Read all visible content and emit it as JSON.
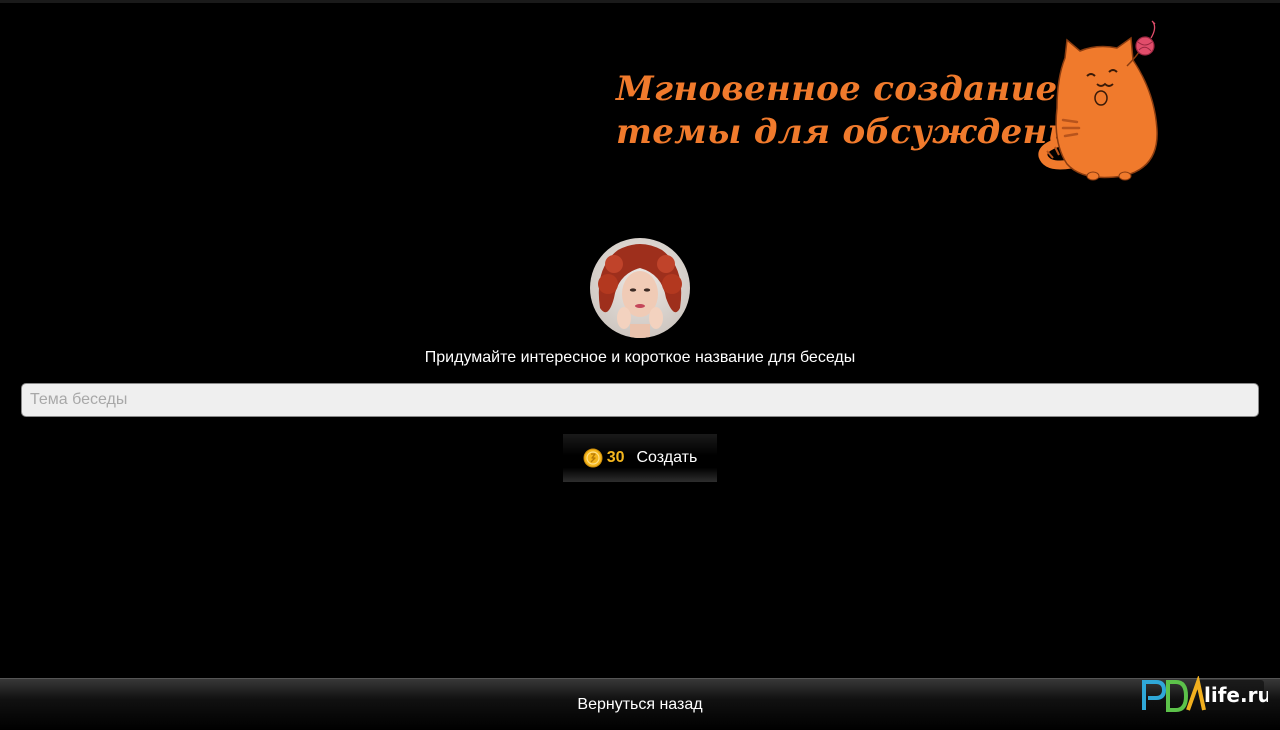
{
  "promo": {
    "line1": "Мгновенное создание",
    "line2": "темы для обсуждения!",
    "mascot_icon": "cat-with-yarn-icon",
    "accent_color": "#f07a2c"
  },
  "profile": {
    "avatar_icon": "user-avatar-photo"
  },
  "form": {
    "prompt": "Придумайте интересное и короткое название для беседы",
    "topic_placeholder": "Тема беседы",
    "topic_value": ""
  },
  "create_button": {
    "coin_icon": "coin-icon",
    "cost": "30",
    "label": "Создать",
    "coin_color": "#f5b71e"
  },
  "footer": {
    "back_label": "Вернуться назад"
  },
  "watermark": {
    "text": "life.ru"
  }
}
